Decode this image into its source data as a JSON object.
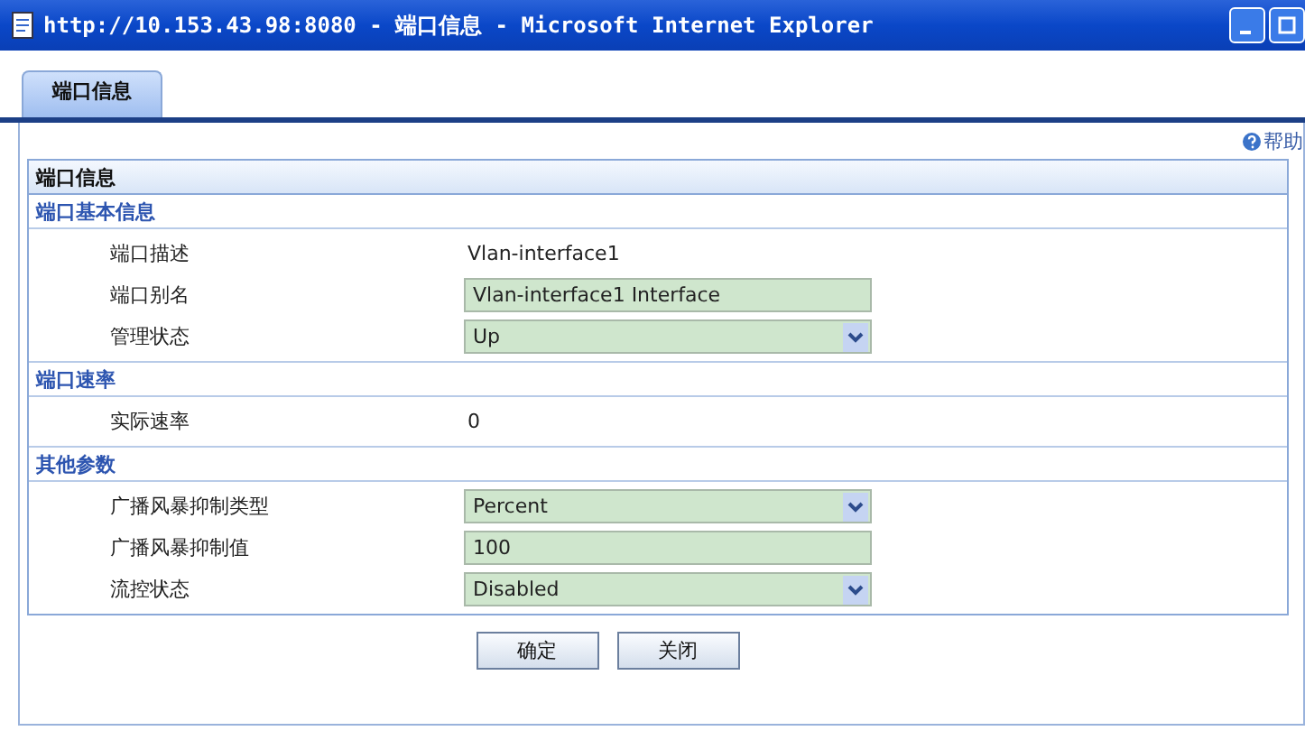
{
  "window": {
    "title": "http://10.153.43.98:8080 - 端口信息 - Microsoft Internet Explorer"
  },
  "tabs": [
    {
      "label": "端口信息",
      "selected": true
    }
  ],
  "help_link": "帮助",
  "panel": {
    "title": "端口信息",
    "sections": [
      {
        "title": "端口基本信息",
        "rows": [
          {
            "kind": "text",
            "label": "端口描述",
            "value": "Vlan-interface1"
          },
          {
            "kind": "input",
            "label": "端口别名",
            "value": "Vlan-interface1 Interface"
          },
          {
            "kind": "select",
            "label": "管理状态",
            "value": "Up"
          }
        ]
      },
      {
        "title": "端口速率",
        "rows": [
          {
            "kind": "text",
            "label": "实际速率",
            "value": "0"
          }
        ]
      },
      {
        "title": "其他参数",
        "rows": [
          {
            "kind": "select",
            "label": "广播风暴抑制类型",
            "value": "Percent"
          },
          {
            "kind": "input",
            "label": "广播风暴抑制值",
            "value": "100"
          },
          {
            "kind": "select",
            "label": "流控状态",
            "value": "Disabled"
          }
        ]
      }
    ]
  },
  "buttons": [
    "确定",
    "关闭"
  ]
}
